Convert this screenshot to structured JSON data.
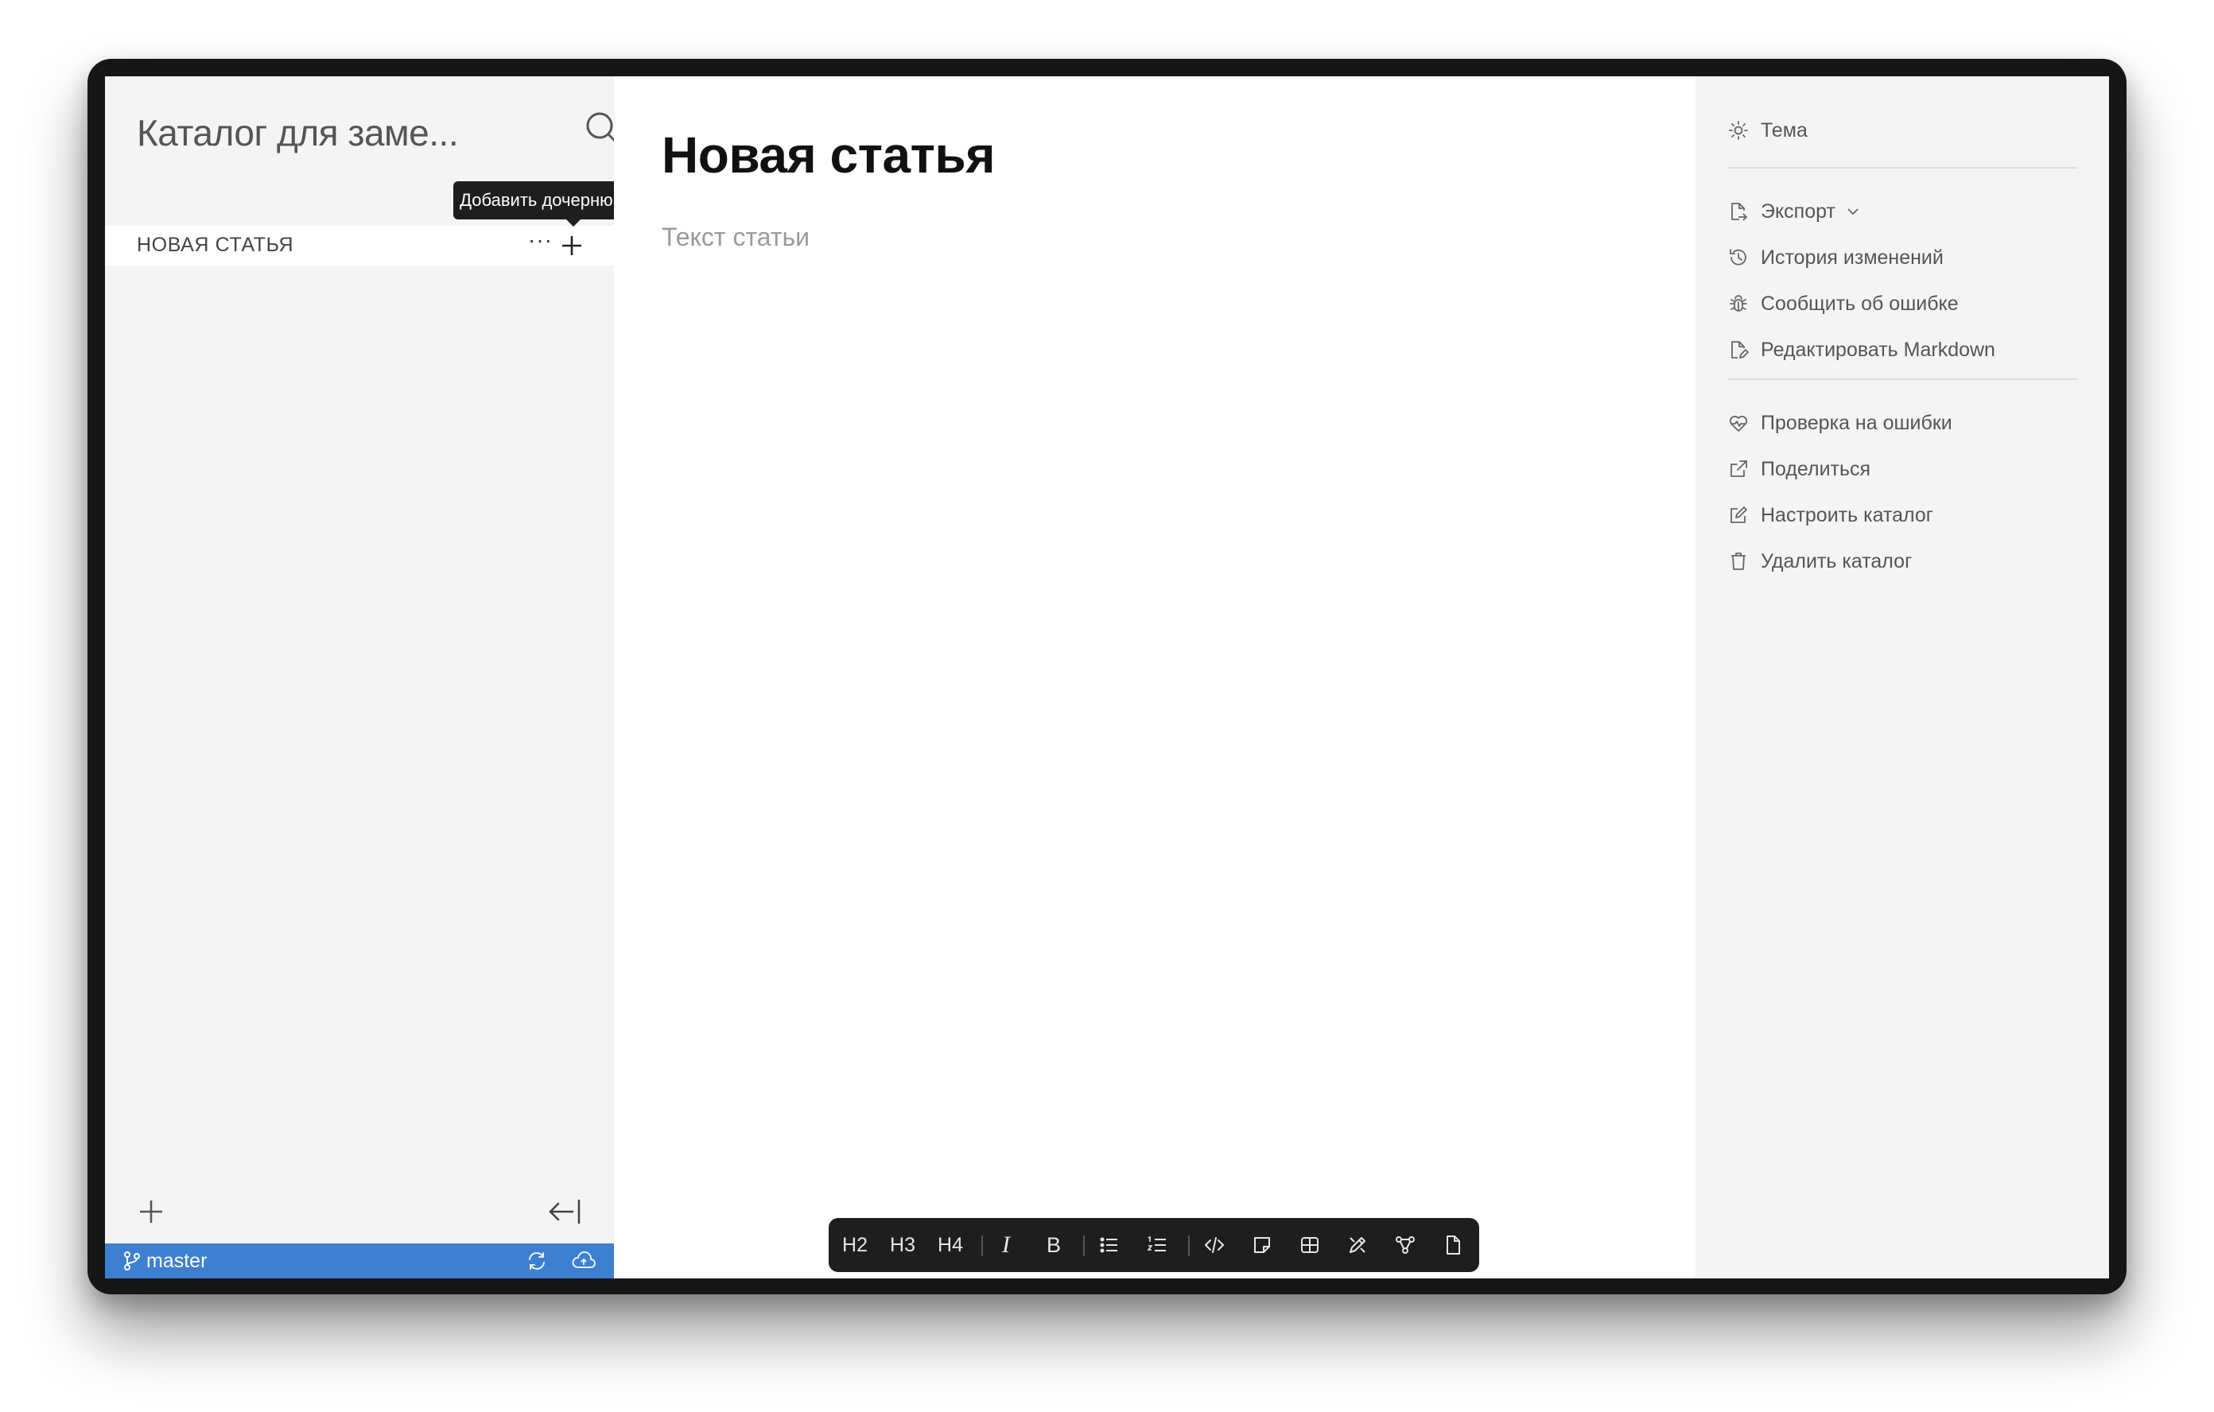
{
  "sidebar": {
    "catalog_title": "Каталог для заме...",
    "tooltip": "Добавить дочернюю статью",
    "article_item": "НОВАЯ СТАТЬЯ",
    "more_glyph": "···",
    "branch": "master"
  },
  "editor": {
    "title": "Новая статья",
    "placeholder": "Текст статьи",
    "toolbar": {
      "h2": "H2",
      "h3": "H3",
      "h4": "H4",
      "italic": "I",
      "bold": "B"
    }
  },
  "right_panel": {
    "theme": "Тема",
    "export": "Экспорт",
    "history": "История изменений",
    "report_bug": "Сообщить об ошибке",
    "edit_markdown": "Редактировать Markdown",
    "check_errors": "Проверка на ошибки",
    "share": "Поделиться",
    "configure_catalog": "Настроить каталог",
    "delete_catalog": "Удалить каталог"
  },
  "colors": {
    "status_bar": "#3d7fd0",
    "sidebar_bg": "#f4f4f4",
    "toolbar_bg": "#1e1e1e"
  }
}
